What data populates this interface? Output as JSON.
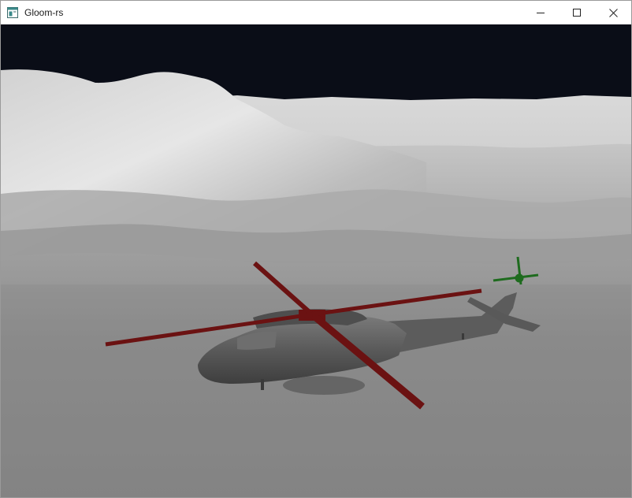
{
  "window": {
    "title": "Gloom-rs",
    "icon": "app-window-icon",
    "controls": {
      "minimize": "minimize-icon",
      "maximize": "maximize-icon",
      "close": "close-icon"
    }
  },
  "scene": {
    "sky_color": "#0a0d17",
    "terrain_color": "#bdbdbd",
    "helicopter_body_color": "#5a5a5a",
    "main_rotor_color": "#6b1212",
    "tail_rotor_color": "#1e6b1e"
  }
}
